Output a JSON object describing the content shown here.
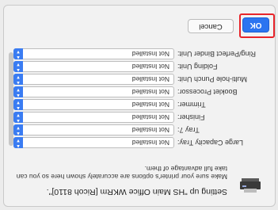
{
  "dialog": {
    "title": "Setting up \"HS Main Office WKRm [Ricoh 8110]\".",
    "description": "Make sure your printer's options are accurately shown here so you can take full advantage of them."
  },
  "options": [
    {
      "label": "Large Capacity Tray:",
      "value": "Not Installed"
    },
    {
      "label": "Tray 7:",
      "value": "Not Installed"
    },
    {
      "label": "Finisher:",
      "value": "Not Installed"
    },
    {
      "label": "Trimmer:",
      "value": "Not Installed"
    },
    {
      "label": "Booklet Processor:",
      "value": "Not Installed"
    },
    {
      "label": "Multi-hole Punch Unit:",
      "value": "Not Installed"
    },
    {
      "label": "Folding Unit:",
      "value": "Not Installed"
    },
    {
      "label": "Ring/Perfect Binder Unit:",
      "value": "Not Installed"
    }
  ],
  "buttons": {
    "cancel_label": "Cancel",
    "ok_label": "OK"
  },
  "colors": {
    "accent": "#2b74f0",
    "highlight": "#e8242a"
  }
}
